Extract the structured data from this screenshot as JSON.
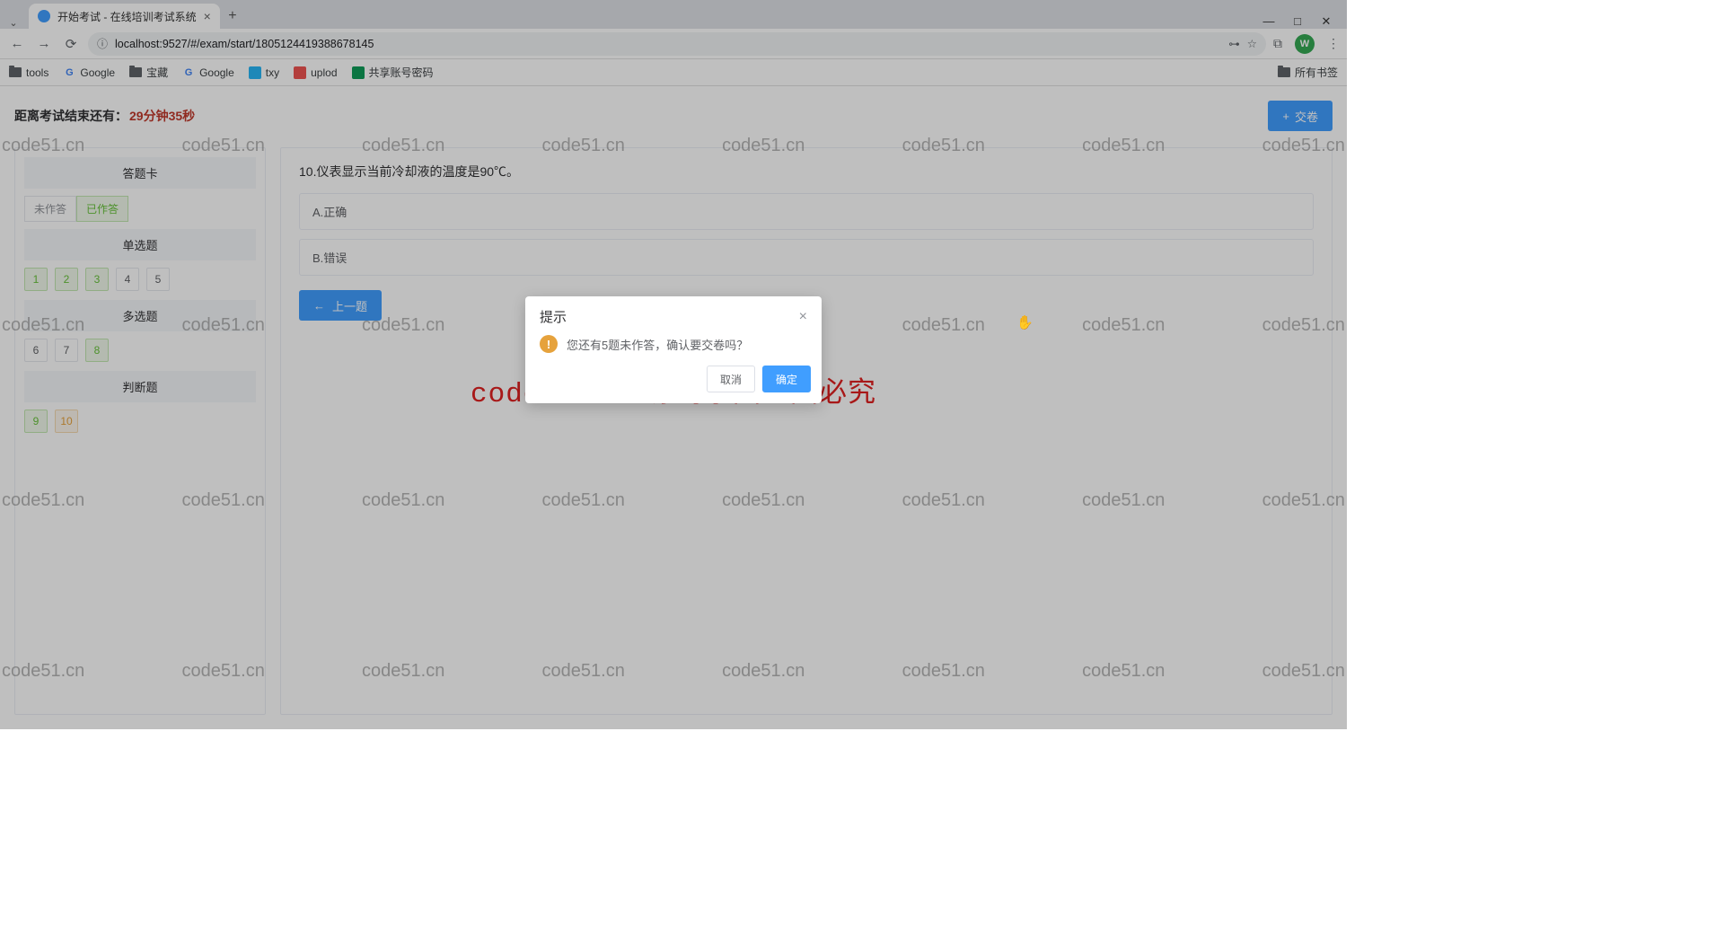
{
  "browser": {
    "tab_title": "开始考试 - 在线培训考试系统",
    "url": "localhost:9527/#/exam/start/1805124419388678145",
    "avatar_letter": "W",
    "bookmarks": [
      "tools",
      "Google",
      "宝藏",
      "Google",
      "txy",
      "uplod",
      "共享账号密码"
    ],
    "all_bookmarks": "所有书签"
  },
  "header": {
    "timer_label": "距离考试结束还有：",
    "timer_value": "29分钟35秒",
    "submit_label": "交卷"
  },
  "sidebar": {
    "card_title": "答题卡",
    "legend_unanswered": "未作答",
    "legend_answered": "已作答",
    "sections": [
      {
        "title": "单选题",
        "items": [
          {
            "n": "1",
            "state": "answered"
          },
          {
            "n": "2",
            "state": "answered"
          },
          {
            "n": "3",
            "state": "answered"
          },
          {
            "n": "4",
            "state": "unanswered"
          },
          {
            "n": "5",
            "state": "unanswered"
          }
        ]
      },
      {
        "title": "多选题",
        "items": [
          {
            "n": "6",
            "state": "unanswered"
          },
          {
            "n": "7",
            "state": "unanswered"
          },
          {
            "n": "8",
            "state": "answered"
          }
        ]
      },
      {
        "title": "判断题",
        "items": [
          {
            "n": "9",
            "state": "answered"
          },
          {
            "n": "10",
            "state": "current"
          }
        ]
      }
    ]
  },
  "question": {
    "text": "10.仪表显示当前冷却液的温度是90℃。",
    "option_a": "A.正确",
    "option_b": "B.错误",
    "prev_label": "上一题"
  },
  "dialog": {
    "title": "提示",
    "message": "您还有5题未作答，确认要交卷吗？",
    "cancel": "取消",
    "ok": "确定"
  },
  "watermark": {
    "small": "code51.cn",
    "big": "code51.cn-源码乐园盗图必究"
  }
}
